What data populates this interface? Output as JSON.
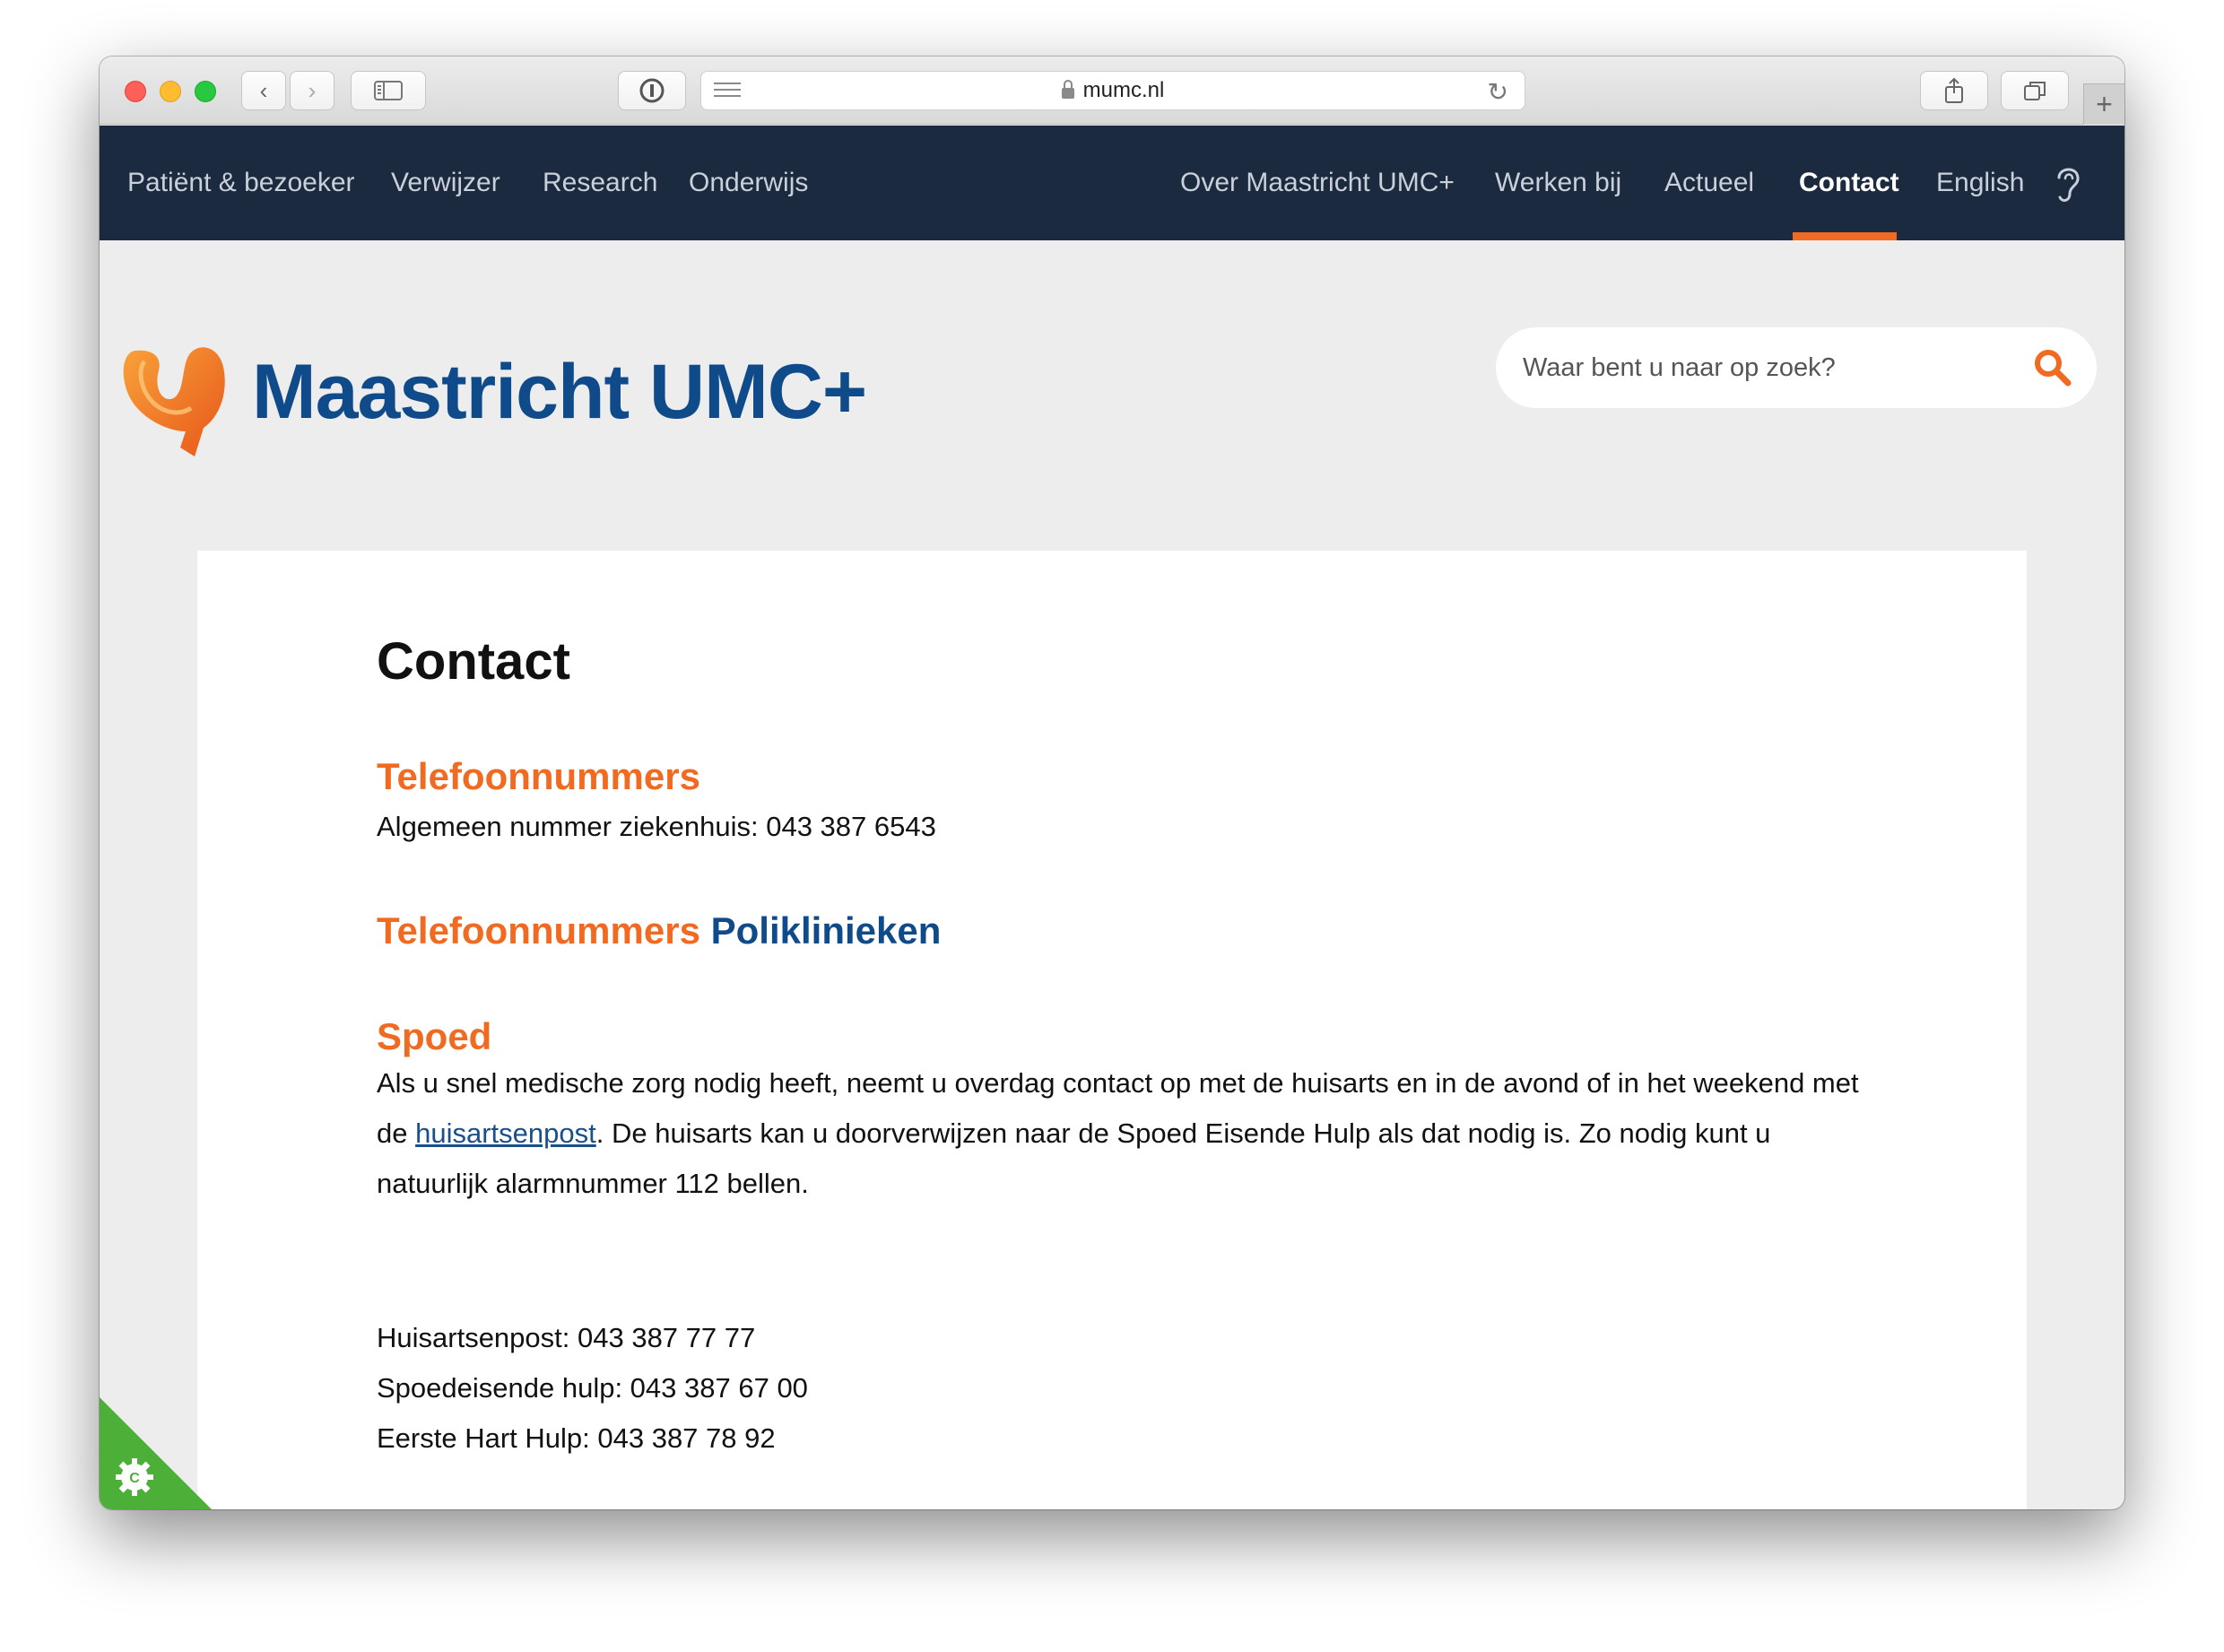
{
  "browser": {
    "url": "mumc.nl"
  },
  "nav": {
    "left": [
      "Patiënt & bezoeker",
      "Verwijzer",
      "Research",
      "Onderwijs"
    ],
    "right": [
      "Over Maastricht UMC+",
      "Werken bij",
      "Actueel",
      "Contact",
      "English"
    ],
    "active": "Contact"
  },
  "header": {
    "logo_text": "Maastricht UMC+",
    "search_placeholder": "Waar bent u naar op zoek?"
  },
  "content": {
    "title": "Contact",
    "section1": {
      "heading": "Telefoonnummers",
      "text": "Algemeen nummer ziekenhuis: 043 387 6543"
    },
    "section2": {
      "heading_orange": "Telefoonnummers",
      "heading_blue": "Poliklinieken"
    },
    "section3": {
      "heading": "Spoed",
      "para_part1": "Als u snel medische zorg nodig heeft, neemt u overdag contact op met de huisarts en in de avond of in het weekend met de ",
      "para_link": "huisartsenpost",
      "para_part2": ". De huisarts kan u doorverwijzen naar de Spoed Eisende Hulp als dat nodig is. Zo nodig kunt u natuurlijk alarmnummer 112 bellen.",
      "numbers": [
        "Huisartsenpost: 043 387 77 77",
        "Spoedeisende hulp: 043 387 67 00",
        "Eerste Hart Hulp: 043 387 78 92"
      ]
    }
  },
  "colors": {
    "nav_bg": "#1b2a3f",
    "accent": "#f06b21",
    "brand_blue": "#0f4a8a",
    "cookie_green": "#4caf37"
  }
}
